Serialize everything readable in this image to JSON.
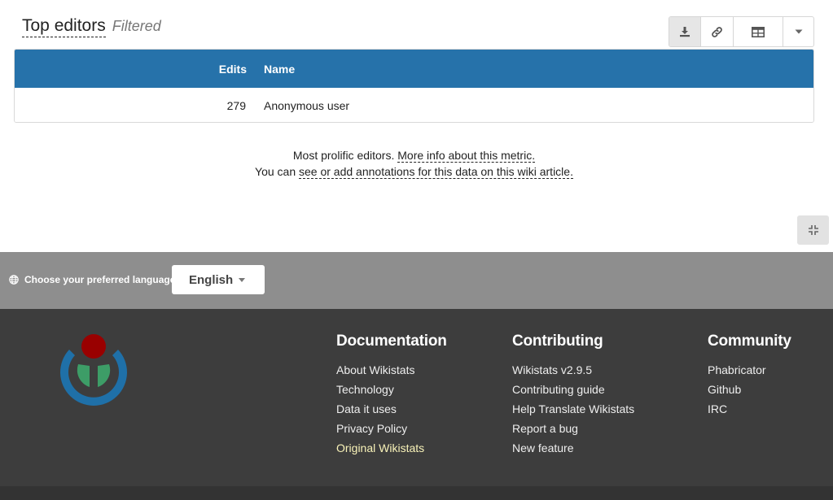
{
  "widget": {
    "title": "Top editors",
    "filter_label": "Filtered",
    "toolbar": {
      "download_icon": "download-icon",
      "link_icon": "link-icon",
      "table_icon": "table-icon",
      "dropdown_icon": "caret-down-icon"
    },
    "table": {
      "columns": [
        "Edits",
        "Name"
      ],
      "rows": [
        {
          "edits": "279",
          "name": "Anonymous user"
        }
      ]
    },
    "description": {
      "line1_prefix": "Most prolific editors.",
      "line1_link": "More info about this metric.",
      "line2_prefix": "You can",
      "line2_link": "see or add annotations for this data on this wiki article."
    },
    "collapse_icon": "compress-icon"
  },
  "language": {
    "label": "Choose your preferred language",
    "selected": "English",
    "icon": "globe-icon"
  },
  "footer": {
    "logo": "wikimedia-logo",
    "columns": [
      {
        "heading": "Documentation",
        "links": [
          "About Wikistats",
          "Technology",
          "Data it uses",
          "Privacy Policy",
          "Original Wikistats"
        ]
      },
      {
        "heading": "Contributing",
        "links": [
          "Wikistats v2.9.5",
          "Contributing guide",
          "Help Translate Wikistats",
          "Report a bug",
          "New feature"
        ]
      },
      {
        "heading": "Community",
        "links": [
          "Phabricator",
          "Github",
          "IRC"
        ]
      }
    ]
  },
  "colors": {
    "table_header": "#2672aa",
    "language_bar": "#8e8e8e",
    "footer_bg": "#3d3d3d",
    "highlight_link": "#f8f2b8"
  }
}
